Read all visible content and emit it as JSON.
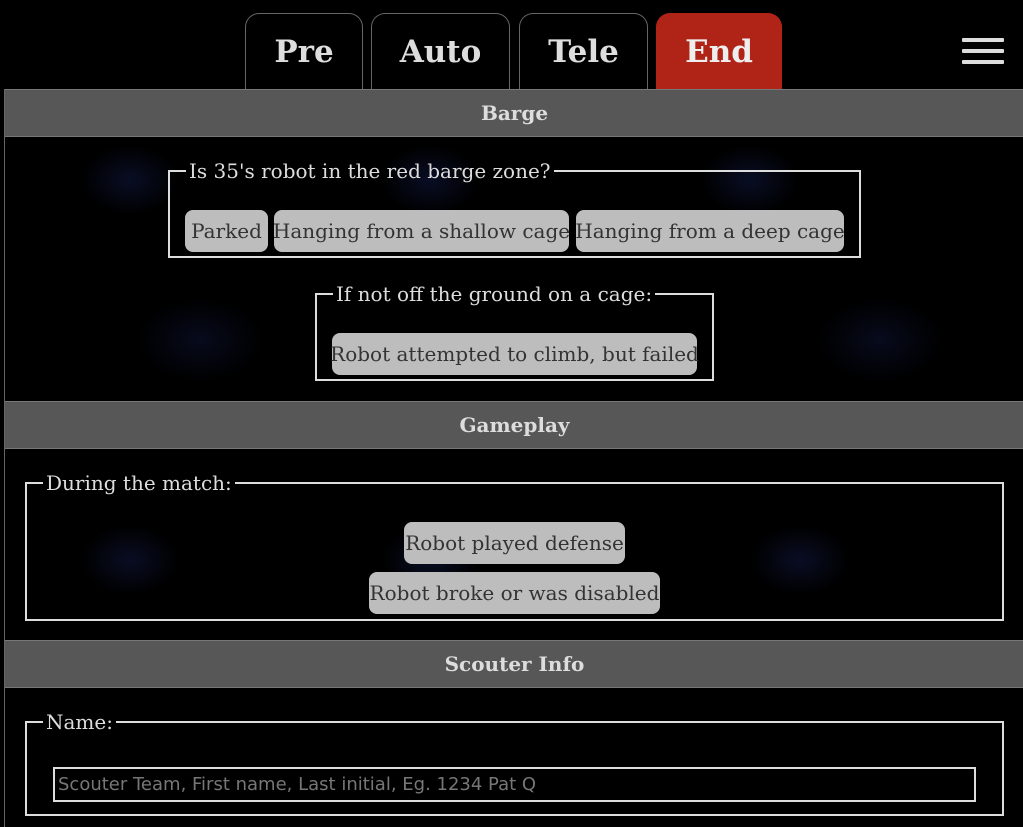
{
  "tabs": [
    {
      "label": "Pre",
      "active": false
    },
    {
      "label": "Auto",
      "active": false
    },
    {
      "label": "Tele",
      "active": false
    },
    {
      "label": "End",
      "active": true
    }
  ],
  "menu": {
    "icon": "hamburger-menu-icon"
  },
  "colors": {
    "active_tab": "#b02418",
    "section_header": "#575757",
    "option_button": "#bdbdbd",
    "background": "#000000"
  },
  "barge": {
    "header": "Barge",
    "zone_legend": "Is 35's robot in the red barge zone?",
    "zone_options": [
      "Parked",
      "Hanging from a shallow cage",
      "Hanging from a deep cage"
    ],
    "failed_legend": "If not off the ground on a cage:",
    "failed_option": "Robot attempted to climb, but failed"
  },
  "gameplay": {
    "header": "Gameplay",
    "match_legend": "During the match:",
    "defense_option": "Robot played defense",
    "disabled_option": "Robot broke or was disabled"
  },
  "scouter_info": {
    "header": "Scouter Info",
    "name_legend": "Name:",
    "name_placeholder": "Scouter Team, First name, Last initial, Eg. 1234 Pat Q",
    "name_value": ""
  }
}
